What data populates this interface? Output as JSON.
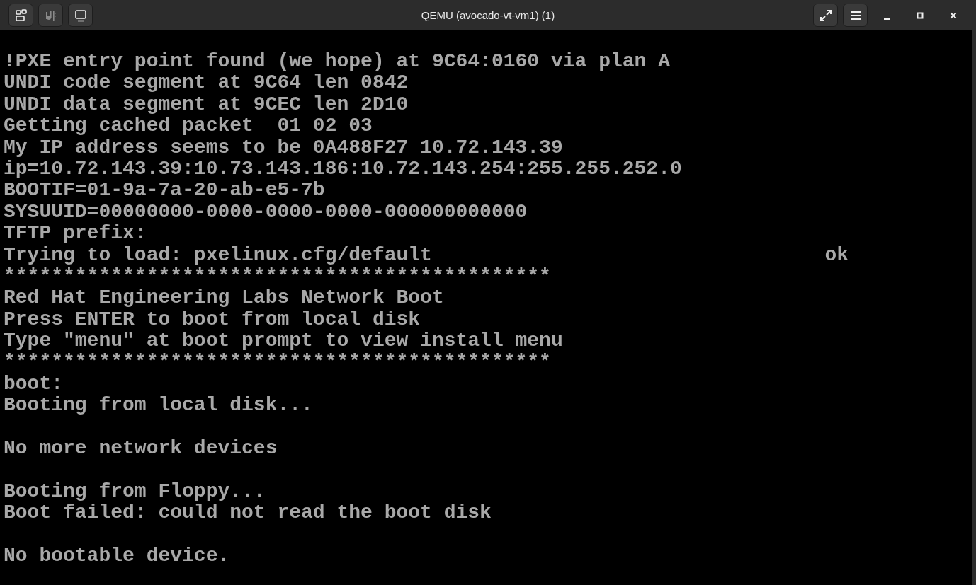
{
  "window": {
    "title": "QEMU (avocado-vt-vm1) (1)"
  },
  "toolbar_left": [
    {
      "kind": "views",
      "disabled": false
    },
    {
      "kind": "media",
      "disabled": true
    },
    {
      "kind": "display",
      "disabled": false
    }
  ],
  "toolbar_right": [
    {
      "kind": "fullscreen"
    },
    {
      "kind": "menu"
    }
  ],
  "console": {
    "lines": [
      {
        "text": "!PXE entry point found (we hope) at 9C64:0160 via plan A"
      },
      {
        "text": "UNDI code segment at 9C64 len 0842"
      },
      {
        "text": "UNDI data segment at 9CEC len 2D10"
      },
      {
        "text": "Getting cached packet  01 02 03"
      },
      {
        "text": "My IP address seems to be 0A488F27 10.72.143.39"
      },
      {
        "text": "ip=10.72.143.39:10.73.143.186:10.72.143.254:255.255.252.0"
      },
      {
        "text": "BOOTIF=01-9a-7a-20-ab-e5-7b"
      },
      {
        "text": "SYSUUID=00000000-0000-0000-0000-000000000000"
      },
      {
        "text": "TFTP prefix:"
      },
      {
        "text": "Trying to load: pxelinux.cfg/default",
        "status": "ok"
      },
      {
        "text": "**********************************************"
      },
      {
        "text": "Red Hat Engineering Labs Network Boot"
      },
      {
        "text": "Press ENTER to boot from local disk"
      },
      {
        "text": "Type \"menu\" at boot prompt to view install menu"
      },
      {
        "text": "**********************************************"
      },
      {
        "text": "boot:"
      },
      {
        "text": "Booting from local disk..."
      },
      {
        "text": "No more network devices",
        "space_before": true
      },
      {
        "text": "Booting from Floppy...",
        "space_before": true
      },
      {
        "text": "Boot failed: could not read the boot disk"
      },
      {
        "text": "No bootable device.",
        "space_before": true
      }
    ]
  }
}
